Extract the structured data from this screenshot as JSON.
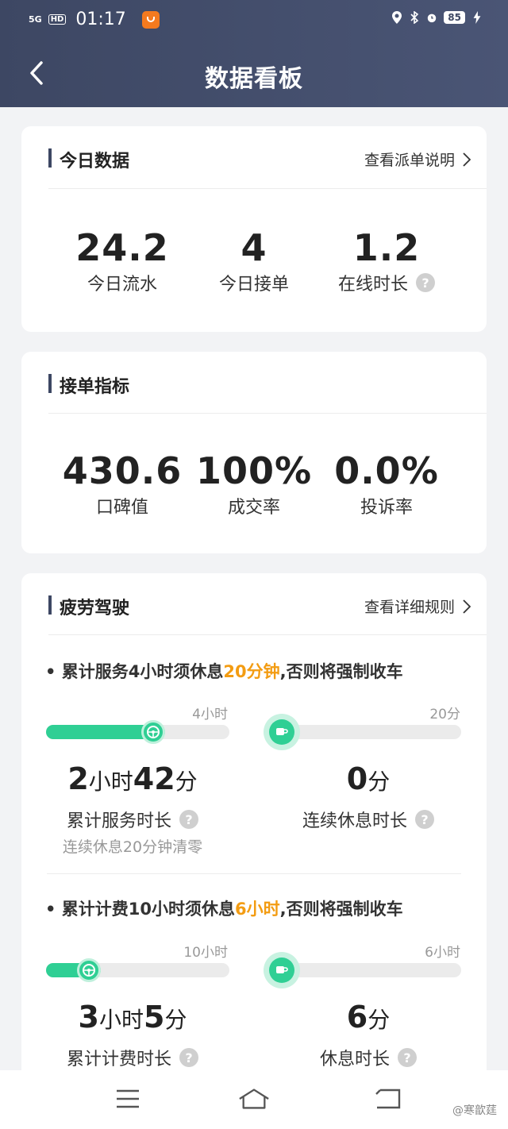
{
  "status_bar": {
    "signal": "5G",
    "hd": "HD",
    "time": "01:17",
    "battery": "85"
  },
  "header": {
    "title": "数据看板"
  },
  "today": {
    "title": "今日数据",
    "link": "查看派单说明",
    "stats": [
      {
        "value": "24.2",
        "label": "今日流水"
      },
      {
        "value": "4",
        "label": "今日接单"
      },
      {
        "value": "1.2",
        "label": "在线时长"
      }
    ]
  },
  "metrics": {
    "title": "接单指标",
    "stats": [
      {
        "value": "430.6",
        "label": "口碑值"
      },
      {
        "value": "100%",
        "label": "成交率"
      },
      {
        "value": "0.0%",
        "label": "投诉率"
      }
    ]
  },
  "fatigue": {
    "title": "疲劳驾驶",
    "link": "查看详细规则",
    "rule1": {
      "prefix": "• 累计服务4小时须休息",
      "highlight": "20分钟",
      "suffix": ",否则将强制收车"
    },
    "block1": {
      "left_cap": "4小时",
      "left_progress": 0.65,
      "right_cap": "20分",
      "right_progress": 0,
      "left_value": {
        "h": "2",
        "h_unit": "小时",
        "m": "42",
        "m_unit": "分"
      },
      "left_label": "累计服务时长",
      "left_note": "连续休息20分钟清零",
      "right_value": {
        "m": "0",
        "m_unit": "分"
      },
      "right_label": "连续休息时长"
    },
    "rule2": {
      "prefix": "• 累计计费10小时须休息",
      "highlight": "6小时",
      "suffix": ",否则将强制收车"
    },
    "block2": {
      "left_cap": "10小时",
      "left_progress": 0.3,
      "right_cap": "6小时",
      "right_progress": 0,
      "left_value": {
        "h": "3",
        "h_unit": "小时",
        "m": "5",
        "m_unit": "分"
      },
      "left_label": "累计计费时长",
      "right_value": {
        "m": "6",
        "m_unit": "分"
      },
      "right_label": "休息时长"
    }
  },
  "watermark": "@寒歆莛",
  "colors": {
    "header": "#3d4763",
    "accent": "#2fcf94",
    "highlight": "#f39c12"
  }
}
